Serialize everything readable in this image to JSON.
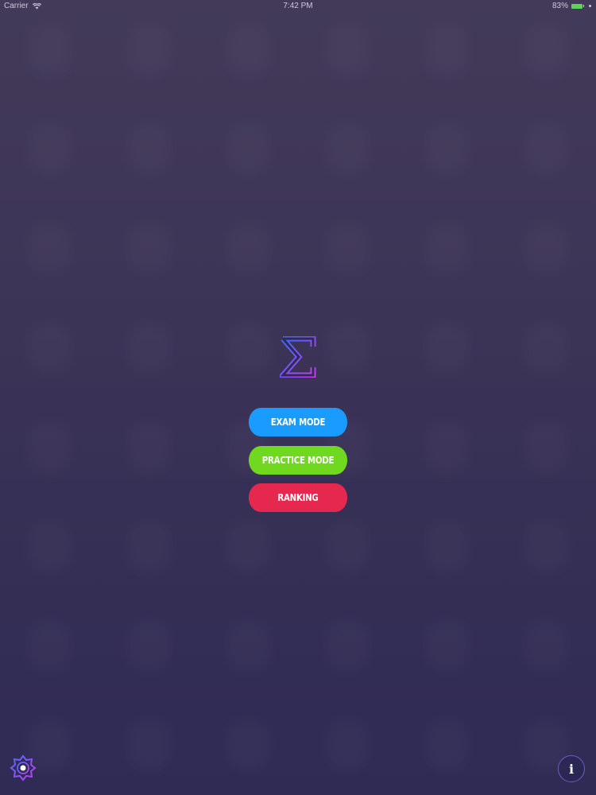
{
  "status_bar": {
    "carrier": "Carrier",
    "time": "7:42 PM",
    "battery": "83%"
  },
  "logo": {
    "symbol": "Σ",
    "icon": "sigma-icon",
    "gradient_start": "#3b6bff",
    "gradient_end": "#c23cf0"
  },
  "menu": {
    "exam_label": "EXAM MODE",
    "practice_label": "PRACTICE MODE",
    "ranking_label": "RANKING",
    "exam_color": "#1a9bff",
    "practice_color": "#6fd81f",
    "ranking_color": "#e6284f"
  },
  "footer": {
    "settings_icon": "gear-icon",
    "info_icon": "info-icon",
    "info_glyph": "i"
  }
}
